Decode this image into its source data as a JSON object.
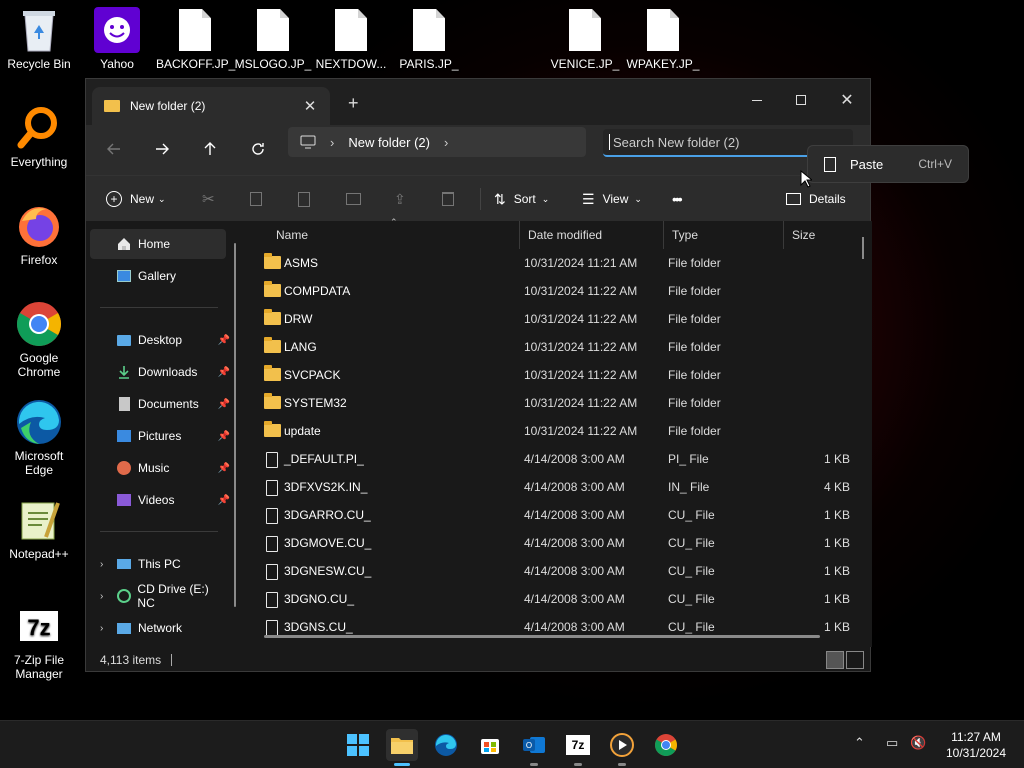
{
  "desktop": {
    "icons": [
      {
        "label": "Recycle Bin"
      },
      {
        "label": "Yahoo"
      },
      {
        "label": "BACKOFF.JP_"
      },
      {
        "label": "MSLOGO.JP_"
      },
      {
        "label": "NEXTDOW..."
      },
      {
        "label": "PARIS.JP_"
      },
      {
        "label": "VENICE.JP_"
      },
      {
        "label": "WPAKEY.JP_"
      },
      {
        "label": "Everything"
      },
      {
        "label": "Firefox"
      },
      {
        "label": "Google Chrome"
      },
      {
        "label": "Microsoft Edge"
      },
      {
        "label": "Notepad++"
      },
      {
        "label": "7-Zip File Manager"
      }
    ]
  },
  "window": {
    "tab_title": "New folder (2)",
    "new_tab": "+",
    "breadcrumb": "New folder (2)",
    "search_placeholder": "Search New folder (2)",
    "toolbar": {
      "new": "New",
      "sort": "Sort",
      "view": "View",
      "more": "•••",
      "details": "Details"
    },
    "sidebar": {
      "items": [
        {
          "label": "Home"
        },
        {
          "label": "Gallery"
        },
        {
          "label": "Desktop"
        },
        {
          "label": "Downloads"
        },
        {
          "label": "Documents"
        },
        {
          "label": "Pictures"
        },
        {
          "label": "Music"
        },
        {
          "label": "Videos"
        },
        {
          "label": "This PC"
        },
        {
          "label": "CD Drive (E:) NC"
        },
        {
          "label": "Network"
        }
      ]
    },
    "columns": {
      "name": "Name",
      "date": "Date modified",
      "type": "Type",
      "size": "Size"
    },
    "files": [
      {
        "name": "ASMS",
        "date": "10/31/2024 11:21 AM",
        "type": "File folder",
        "size": ""
      },
      {
        "name": "COMPDATA",
        "date": "10/31/2024 11:22 AM",
        "type": "File folder",
        "size": ""
      },
      {
        "name": "DRW",
        "date": "10/31/2024 11:22 AM",
        "type": "File folder",
        "size": ""
      },
      {
        "name": "LANG",
        "date": "10/31/2024 11:22 AM",
        "type": "File folder",
        "size": ""
      },
      {
        "name": "SVCPACK",
        "date": "10/31/2024 11:22 AM",
        "type": "File folder",
        "size": ""
      },
      {
        "name": "SYSTEM32",
        "date": "10/31/2024 11:22 AM",
        "type": "File folder",
        "size": ""
      },
      {
        "name": "update",
        "date": "10/31/2024 11:22 AM",
        "type": "File folder",
        "size": ""
      },
      {
        "name": "_DEFAULT.PI_",
        "date": "4/14/2008 3:00 AM",
        "type": "PI_ File",
        "size": "1 KB"
      },
      {
        "name": "3DFXVS2K.IN_",
        "date": "4/14/2008 3:00 AM",
        "type": "IN_ File",
        "size": "4 KB"
      },
      {
        "name": "3DGARRO.CU_",
        "date": "4/14/2008 3:00 AM",
        "type": "CU_ File",
        "size": "1 KB"
      },
      {
        "name": "3DGMOVE.CU_",
        "date": "4/14/2008 3:00 AM",
        "type": "CU_ File",
        "size": "1 KB"
      },
      {
        "name": "3DGNESW.CU_",
        "date": "4/14/2008 3:00 AM",
        "type": "CU_ File",
        "size": "1 KB"
      },
      {
        "name": "3DGNO.CU_",
        "date": "4/14/2008 3:00 AM",
        "type": "CU_ File",
        "size": "1 KB"
      },
      {
        "name": "3DGNS.CU_",
        "date": "4/14/2008 3:00 AM",
        "type": "CU_ File",
        "size": "1 KB"
      }
    ],
    "status": "4,113 items"
  },
  "context_menu": {
    "paste": "Paste",
    "shortcut": "Ctrl+V"
  },
  "taskbar": {
    "time": "11:27 AM",
    "date": "10/31/2024"
  },
  "colors": {
    "accent": "#4aa0e6",
    "folder": "#f2c04c",
    "window_bg": "#191919",
    "toolbar_bg": "#2c2c2c"
  }
}
